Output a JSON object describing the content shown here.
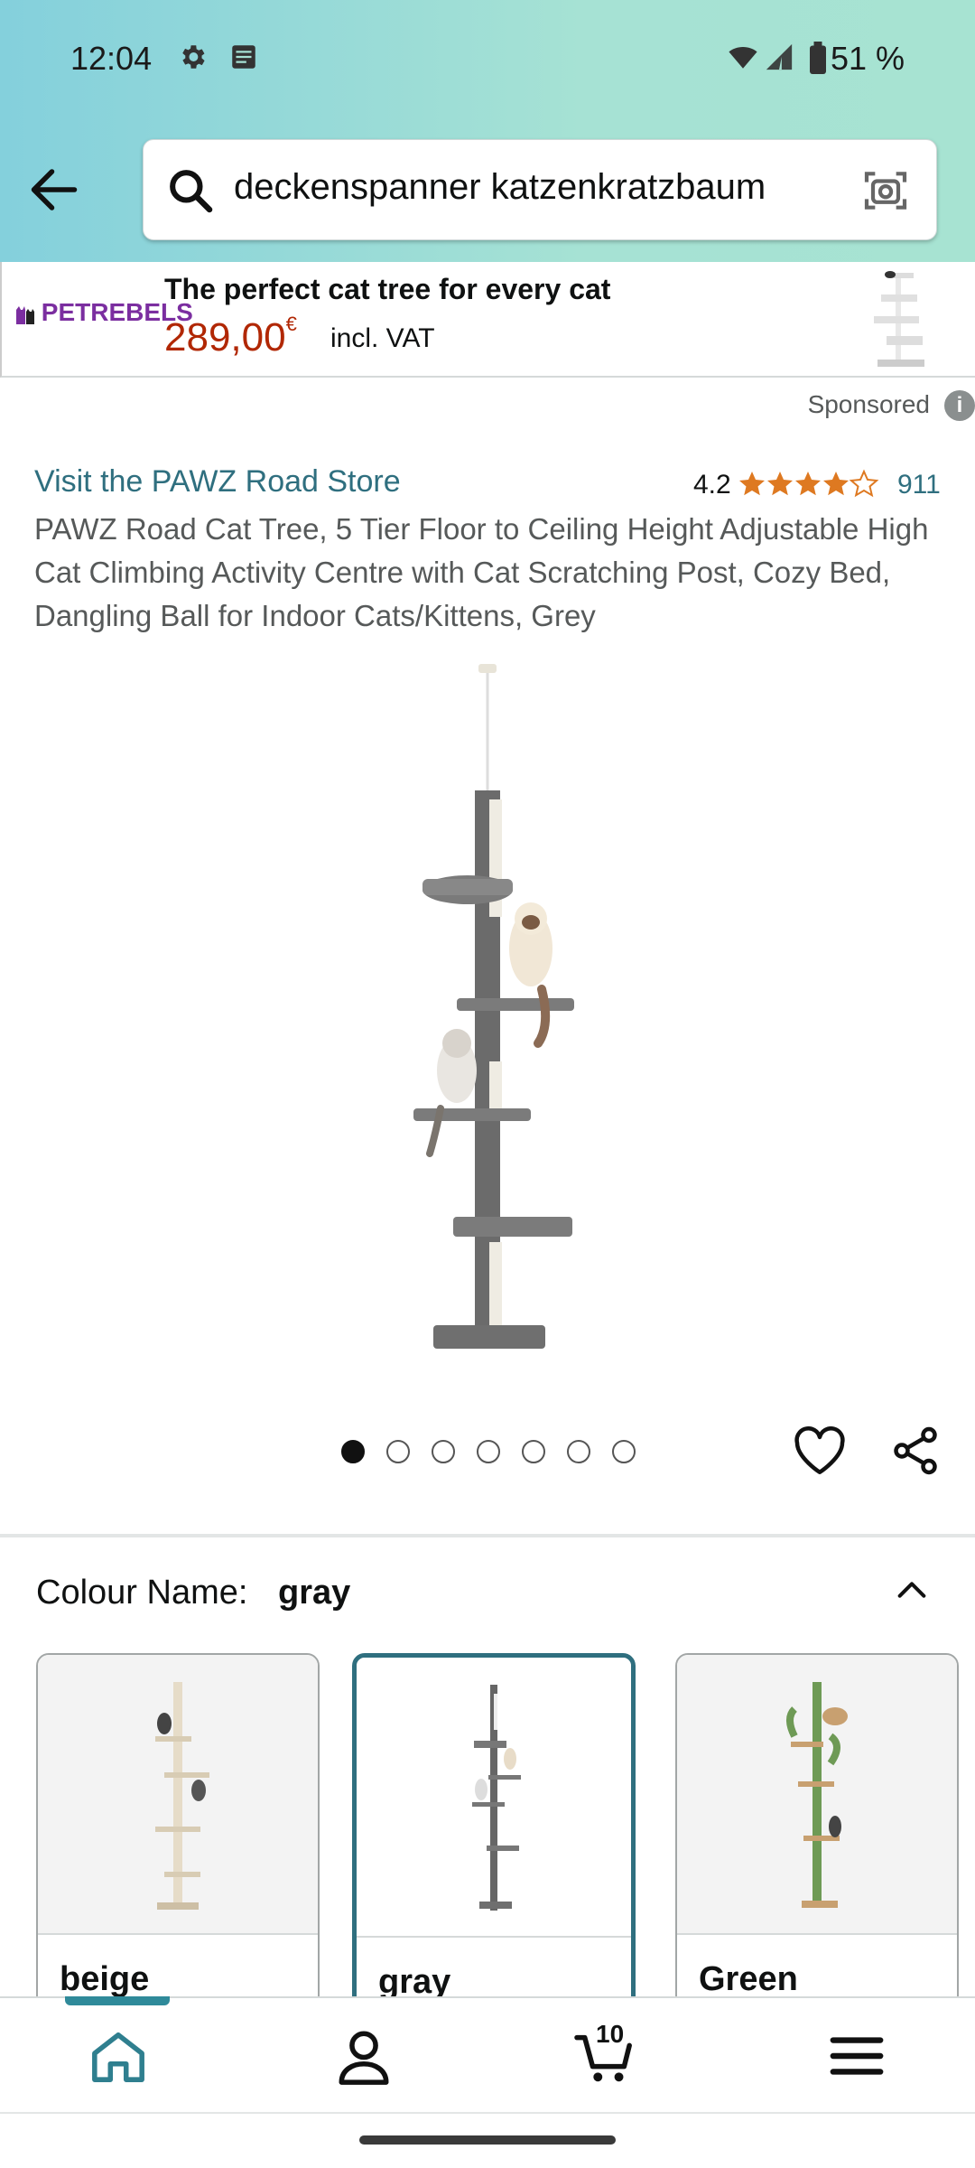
{
  "status_bar": {
    "time": "12:04",
    "battery": "51 %"
  },
  "search": {
    "query": "deckenspanner katzenkratzbaum"
  },
  "ad": {
    "brand": "PETREBELS",
    "title": "The perfect cat tree for every cat",
    "price": "289,00",
    "currency": "€",
    "vat_note": "incl. VAT",
    "sponsored": "Sponsored"
  },
  "product": {
    "store_link": "Visit the PAWZ Road Store",
    "rating": "4.2",
    "rating_value": 4.2,
    "review_count": "911",
    "title": "PAWZ Road Cat Tree, 5 Tier Floor to Ceiling Height Adjustable High Cat Climbing Activity Centre with Cat Scratching Post, Cozy Bed, Dangling Ball for Indoor Cats/Kittens, Grey",
    "image_count": 7,
    "active_image": 1
  },
  "colour": {
    "label": "Colour Name:",
    "selected": "gray",
    "options": [
      {
        "name": "beige"
      },
      {
        "name": "gray"
      },
      {
        "name": "Green"
      }
    ]
  },
  "bottom_nav": {
    "cart_count": "10"
  },
  "colors": {
    "accent": "#2f6f7f",
    "price": "#b12704",
    "star": "#de7921"
  }
}
